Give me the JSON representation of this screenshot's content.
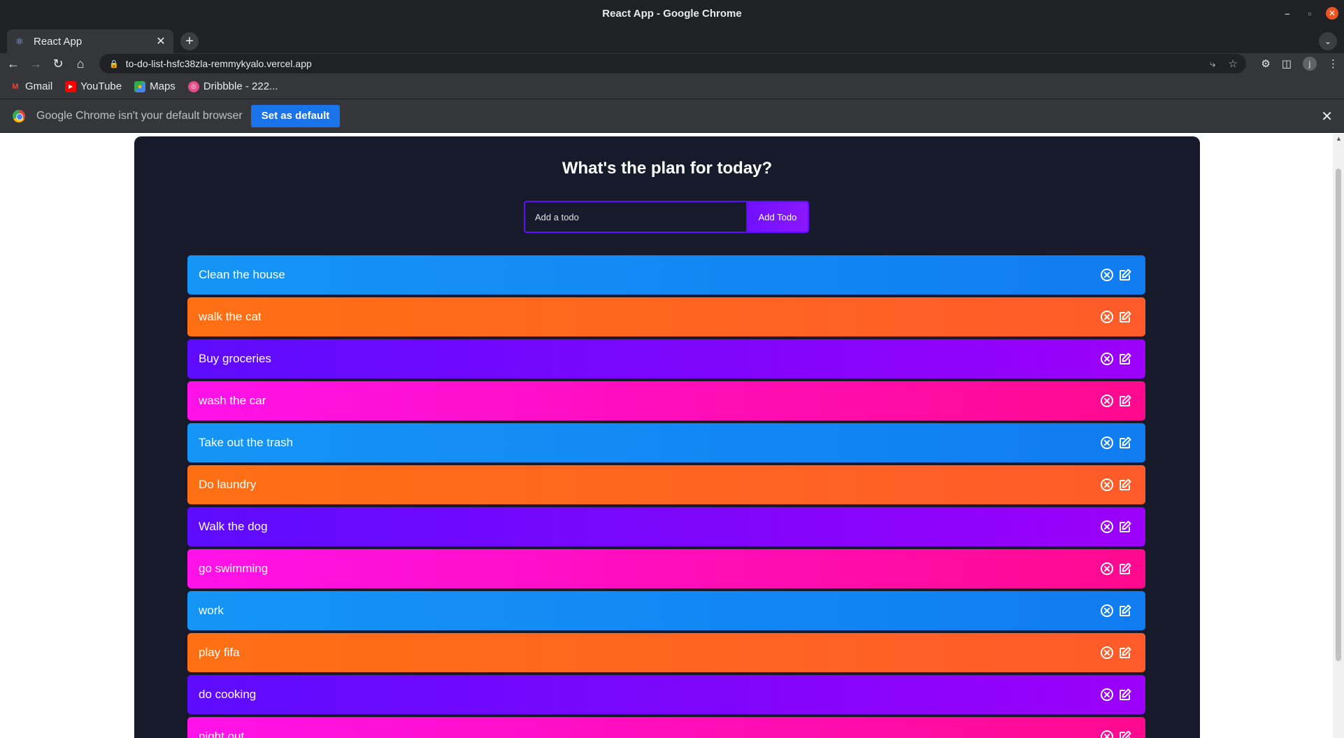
{
  "window": {
    "title": "React App - Google Chrome",
    "minimize_glyph": "–",
    "maximize_glyph": "▫",
    "close_glyph": "✕"
  },
  "tabs": [
    {
      "title": "React App",
      "icon": "react-icon",
      "close_glyph": "✕"
    }
  ],
  "new_tab_glyph": "+",
  "tab_search_glyph": "⌄",
  "toolbar": {
    "url": "to-do-list-hsfc38zla-remmykyalo.vercel.app",
    "profile_initial": "j"
  },
  "bookmarks": [
    {
      "label": "Gmail",
      "icon": "gmail-icon",
      "color": "#ea4335"
    },
    {
      "label": "YouTube",
      "icon": "youtube-icon",
      "color": "#ff0000"
    },
    {
      "label": "Maps",
      "icon": "maps-icon",
      "color": "#34a853"
    },
    {
      "label": "Dribbble - 222...",
      "icon": "dribbble-icon",
      "color": "#ea4c89"
    }
  ],
  "infobar": {
    "message": "Google Chrome isn't your default browser",
    "button_label": "Set as default",
    "close_glyph": "✕"
  },
  "app": {
    "title": "What's the plan for today?",
    "input_placeholder": "Add a todo",
    "input_value": "",
    "add_button_label": "Add Todo",
    "accent_color": "#5d0cff",
    "background_color": "#161a2b",
    "todos": [
      "Clean the house",
      "walk the cat",
      "Buy groceries",
      "wash the car",
      "Take out the trash",
      "Do laundry",
      "Walk the dog",
      "go swimming",
      "work",
      "play fifa",
      "do cooking",
      "night out"
    ]
  }
}
